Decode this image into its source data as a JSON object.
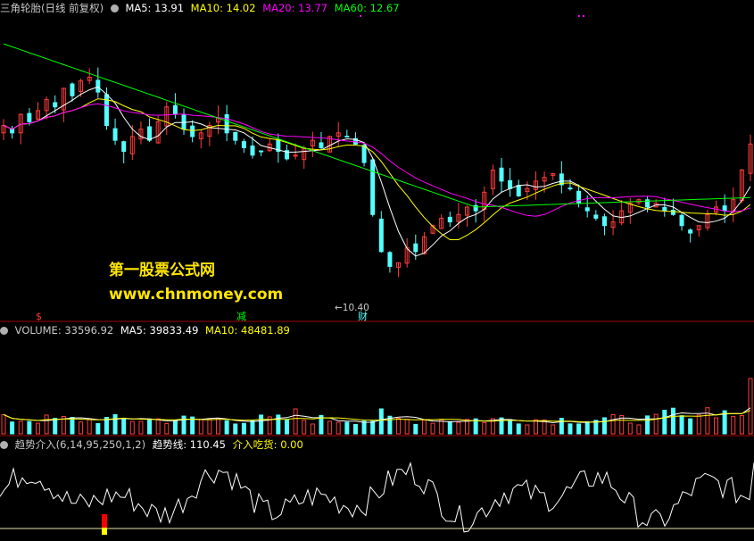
{
  "price_header": {
    "title": "三角轮胎(日线 前复权)",
    "ma5": "MA5: 13.91",
    "ma10": "MA10: 14.02",
    "ma20": "MA20: 13.77",
    "ma60": "MA60: 12.67"
  },
  "volume_header": {
    "title": "VOLUME: 33596.92",
    "ma5": "MA5: 39833.49",
    "ma10": "MA10: 48481.89"
  },
  "indicator_header": {
    "title": "趋势介入(6,14,95,250,1,2)",
    "line": "趋势线: 110.45",
    "buy": "介入吃货: 0.00"
  },
  "watermark": {
    "line1": "第一股票公式网",
    "line2": "www.chnmoney.com"
  },
  "markers": {
    "dollar": "$",
    "reduce": "减",
    "low_label": "←10.40",
    "finance": "财"
  },
  "colors": {
    "up": "#ff3c3c",
    "down": "#54ffff",
    "ma5": "#ffffff",
    "ma10": "#ffff00",
    "ma20": "#ff00ff",
    "ma60": "#00ff00",
    "separator": "#a00000",
    "buy_bar_top": "#ff0000",
    "buy_bar_bottom": "#ffff00"
  },
  "chart_data": [
    {
      "type": "candlestick",
      "title": "三角轮胎(日线 前复权)",
      "series": [
        {
          "name": "MA5",
          "last": 13.91
        },
        {
          "name": "MA10",
          "last": 14.02
        },
        {
          "name": "MA20",
          "last": 13.77
        },
        {
          "name": "MA60",
          "last": 12.67
        }
      ],
      "annotations": [
        {
          "label": "10.40",
          "kind": "period-low"
        }
      ],
      "ohlc_close_approx": [
        14.6,
        14.4,
        14.9,
        14.7,
        15.0,
        15.3,
        15.1,
        15.6,
        15.4,
        15.8,
        15.9,
        15.5,
        14.6,
        14.2,
        13.9,
        14.3,
        14.5,
        14.2,
        14.7,
        15.1,
        14.9,
        14.5,
        14.3,
        14.4,
        14.6,
        14.8,
        14.4,
        14.2,
        14.0,
        13.8,
        13.9,
        14.1,
        13.9,
        13.7,
        13.8,
        14.0,
        14.2,
        14.0,
        14.3,
        14.4,
        14.3,
        14.1,
        13.6,
        12.2,
        11.2,
        10.8,
        10.9,
        11.3,
        11.2,
        11.6,
        11.9,
        12.1,
        12.0,
        12.2,
        12.4,
        12.3,
        12.8,
        13.4,
        13.1,
        12.9,
        12.7,
        12.9,
        13.1,
        13.2,
        13.3,
        13.0,
        12.9,
        12.5,
        12.3,
        12.1,
        11.9,
        12.0,
        12.3,
        12.5,
        12.6,
        12.4,
        12.5,
        12.3,
        12.2,
        11.9,
        11.7,
        11.9,
        12.2,
        12.4,
        12.3,
        12.6,
        13.4,
        14.1
      ]
    },
    {
      "type": "bar",
      "title": "VOLUME",
      "series": [
        {
          "name": "VOLUME",
          "last": 33596.92
        },
        {
          "name": "MA5",
          "last": 39833.49
        },
        {
          "name": "MA10",
          "last": 48481.89
        }
      ]
    },
    {
      "type": "line",
      "title": "趋势介入(6,14,95,250,1,2)",
      "series": [
        {
          "name": "趋势线",
          "last": 110.45
        },
        {
          "name": "介入吃货",
          "last": 0.0
        }
      ]
    }
  ]
}
